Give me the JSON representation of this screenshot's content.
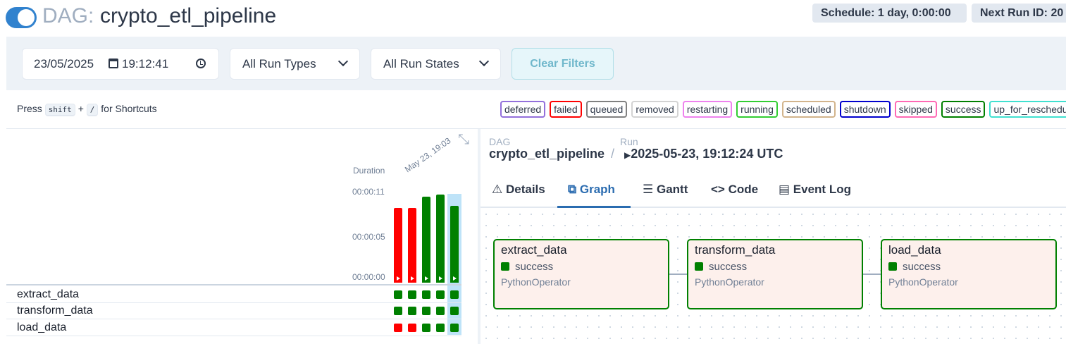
{
  "header": {
    "dag_prefix": "DAG:",
    "dag_id": "crypto_etl_pipeline",
    "paused": false,
    "schedule_badge": "Schedule: 1 day, 0:00:00",
    "next_run_badge": "Next Run ID: 20"
  },
  "filters": {
    "date": "23/05/2025",
    "time": "19:12:41",
    "run_types": "All Run Types",
    "run_states": "All Run States",
    "clear_label": "Clear Filters"
  },
  "shortcuts": {
    "press": "Press",
    "key1": "shift",
    "plus": "+",
    "key2": "/",
    "suffix": "for Shortcuts"
  },
  "legend": [
    {
      "label": "deferred",
      "color": "#9370db"
    },
    {
      "label": "failed",
      "color": "#ff0000"
    },
    {
      "label": "queued",
      "color": "#808080"
    },
    {
      "label": "removed",
      "color": "#d3d3d3"
    },
    {
      "label": "restarting",
      "color": "#ee82ee"
    },
    {
      "label": "running",
      "color": "#32cd32"
    },
    {
      "label": "scheduled",
      "color": "#d2b48c"
    },
    {
      "label": "shutdown",
      "color": "#0000cd"
    },
    {
      "label": "skipped",
      "color": "#ff69b4"
    },
    {
      "label": "success",
      "color": "#008000"
    },
    {
      "label": "up_for_reschedule",
      "color": "#40e0d0"
    }
  ],
  "grid": {
    "duration_label": "Duration",
    "date_label": "May 23, 19:03",
    "ticks": [
      "00:00:11",
      "00:00:05",
      "00:00:00"
    ],
    "runs": [
      {
        "state": "failed",
        "duration_fraction": 0.83,
        "color": "#ff0000"
      },
      {
        "state": "failed",
        "duration_fraction": 0.83,
        "color": "#ff0000"
      },
      {
        "state": "success",
        "duration_fraction": 0.95,
        "color": "#008000"
      },
      {
        "state": "success",
        "duration_fraction": 0.98,
        "color": "#008000"
      },
      {
        "state": "success",
        "duration_fraction": 0.85,
        "color": "#008000"
      }
    ],
    "tasks": [
      {
        "name": "extract_data",
        "states": [
          "success",
          "success",
          "success",
          "success",
          "success"
        ]
      },
      {
        "name": "transform_data",
        "states": [
          "success",
          "success",
          "success",
          "success",
          "success"
        ]
      },
      {
        "name": "load_data",
        "states": [
          "failed",
          "failed",
          "success",
          "success",
          "success"
        ]
      }
    ]
  },
  "details": {
    "dag_label": "DAG",
    "dag_value": "crypto_etl_pipeline",
    "separator": "/",
    "run_label": "Run",
    "run_value": "2025-05-23, 19:12:24 UTC",
    "tabs": [
      "Details",
      "Graph",
      "Gantt",
      "Code",
      "Event Log"
    ],
    "active_tab": "Graph"
  },
  "graph": {
    "nodes": [
      {
        "name": "extract_data",
        "state": "success",
        "operator": "PythonOperator"
      },
      {
        "name": "transform_data",
        "state": "success",
        "operator": "PythonOperator"
      },
      {
        "name": "load_data",
        "state": "success",
        "operator": "PythonOperator"
      }
    ]
  },
  "colors": {
    "success": "#008000",
    "failed": "#ff0000",
    "accent": "#3182ce"
  }
}
